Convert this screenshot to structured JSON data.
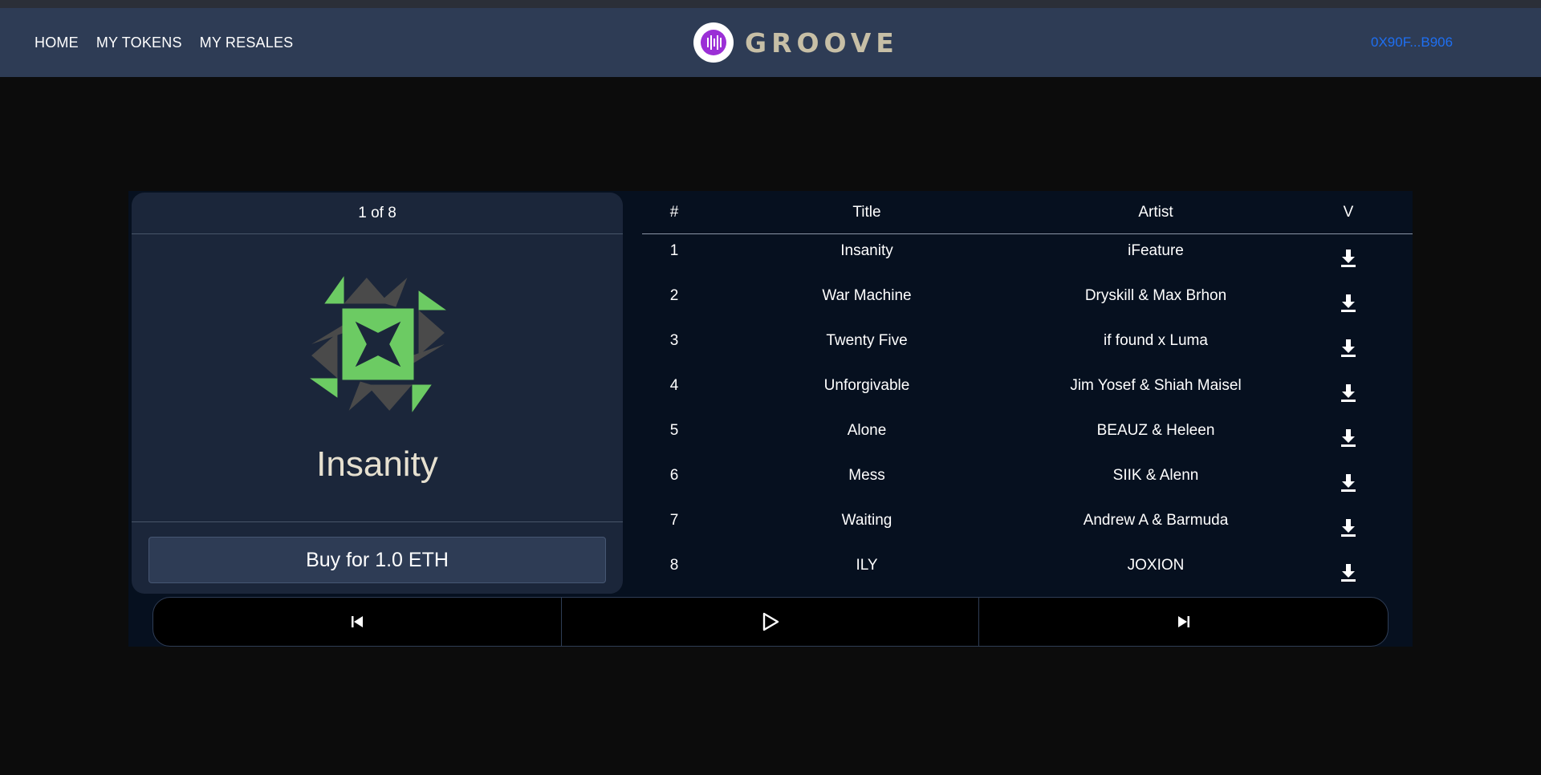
{
  "nav": {
    "links": [
      "HOME",
      "MY TOKENS",
      "MY RESALES"
    ],
    "brand": "GROOVE",
    "wallet": "0X90F...B906"
  },
  "player": {
    "counter": "1 of 8",
    "current_title": "Insanity",
    "buy_label": "Buy for 1.0 ETH",
    "artwork_colors": {
      "primary": "#6ccb63",
      "secondary": "#4a4a4a"
    }
  },
  "tracks": {
    "headers": {
      "num": "#",
      "title": "Title",
      "artist": "Artist",
      "v": "V"
    },
    "rows": [
      {
        "num": "1",
        "title": "Insanity",
        "artist": "iFeature"
      },
      {
        "num": "2",
        "title": "War Machine",
        "artist": "Dryskill & Max Brhon"
      },
      {
        "num": "3",
        "title": "Twenty Five",
        "artist": "if found x Luma"
      },
      {
        "num": "4",
        "title": "Unforgivable",
        "artist": "Jim Yosef & Shiah Maisel"
      },
      {
        "num": "5",
        "title": "Alone",
        "artist": "BEAUZ & Heleen"
      },
      {
        "num": "6",
        "title": "Mess",
        "artist": "SIIK & Alenn"
      },
      {
        "num": "7",
        "title": "Waiting",
        "artist": "Andrew A & Barmuda"
      },
      {
        "num": "8",
        "title": "ILY",
        "artist": "JOXION"
      }
    ]
  },
  "icons": {
    "download": "download-icon",
    "previous": "skip-previous-icon",
    "play": "play-icon",
    "next": "skip-next-icon",
    "logo": "sound-wave-logo-icon"
  },
  "colors": {
    "navbar": "#2e3c55",
    "wallet_link": "#1e6ff2",
    "brand_text": "#c7bfa6",
    "card": "#1b263a",
    "table_bg": "#06101f"
  }
}
